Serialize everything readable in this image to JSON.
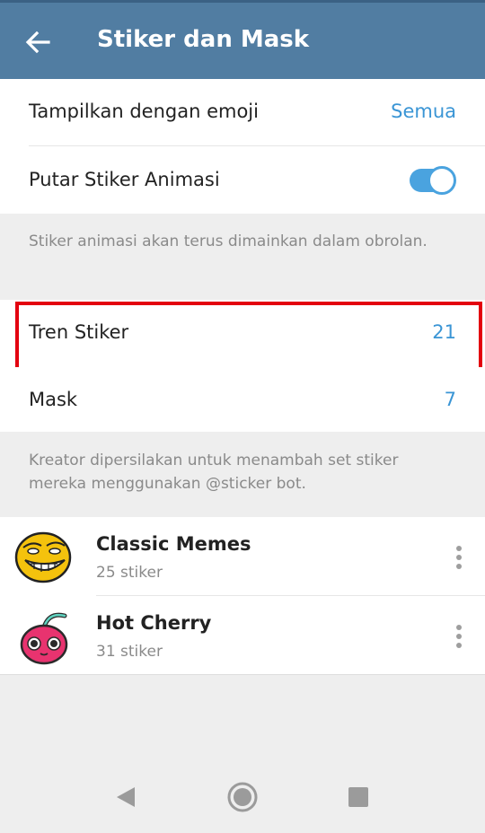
{
  "header": {
    "title": "Stiker dan Mask",
    "back_icon": "arrow-left-icon",
    "bg_color": "#517da2"
  },
  "settings": {
    "emoji": {
      "label": "Tampilkan dengan emoji",
      "value": "Semua"
    },
    "animated": {
      "label": "Putar Stiker Animasi",
      "toggle_on": true
    }
  },
  "info1": "Stiker animasi akan terus dimainkan dalam obrolan.",
  "counts": {
    "trending": {
      "label": "Tren Stiker",
      "value": "21"
    },
    "masks": {
      "label": "Mask",
      "value": "7"
    }
  },
  "info2": "Kreator dipersilakan untuk menambah set stiker mereka menggunakan @sticker bot.",
  "sticker_sets": [
    {
      "name": "Classic Memes",
      "count": "25 stiker",
      "icon": "troll-face-icon"
    },
    {
      "name": "Hot Cherry",
      "count": "31 stiker",
      "icon": "cherry-icon"
    }
  ],
  "colors": {
    "accent": "#3a95d5",
    "highlight": "#e3000f"
  },
  "navbar": [
    "back-triangle-icon",
    "home-circle-icon",
    "recents-square-icon"
  ]
}
